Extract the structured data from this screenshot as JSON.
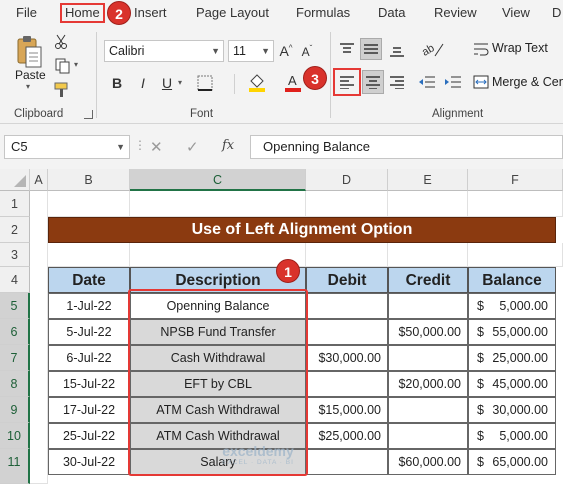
{
  "tabs": [
    "File",
    "Home",
    "Insert",
    "Page Layout",
    "Formulas",
    "Data",
    "Review",
    "View",
    "D"
  ],
  "badges": {
    "one": "1",
    "two": "2",
    "three": "3"
  },
  "clipboard": {
    "paste_label": "Paste",
    "group_label": "Clipboard"
  },
  "font": {
    "name": "Calibri",
    "size": "11",
    "bold": "B",
    "italic": "I",
    "underline": "U",
    "group_label": "Font"
  },
  "alignment": {
    "wrap_text": "Wrap Text",
    "merge_center": "Merge & Cen",
    "group_label": "Alignment"
  },
  "formula_bar": {
    "name_box": "C5",
    "fx": "fx",
    "value": "Openning Balance"
  },
  "columns": [
    "A",
    "B",
    "C",
    "D",
    "E",
    "F"
  ],
  "rows": [
    "1",
    "2",
    "3",
    "4",
    "5",
    "6",
    "7",
    "8",
    "9",
    "10",
    "11"
  ],
  "sheet": {
    "title": "Use of Left Alignment Option",
    "headers": [
      "Date",
      "Description",
      "Debit",
      "Credit",
      "Balance"
    ],
    "records": [
      {
        "date": "1-Jul-22",
        "desc": "Openning Balance",
        "debit": "",
        "credit": "",
        "balance": "5,000.00"
      },
      {
        "date": "5-Jul-22",
        "desc": "NPSB Fund Transfer",
        "debit": "",
        "credit": "$50,000.00",
        "balance": "55,000.00"
      },
      {
        "date": "6-Jul-22",
        "desc": "Cash Withdrawal",
        "debit": "$30,000.00",
        "credit": "",
        "balance": "25,000.00"
      },
      {
        "date": "15-Jul-22",
        "desc": "EFT by CBL",
        "debit": "",
        "credit": "$20,000.00",
        "balance": "45,000.00"
      },
      {
        "date": "17-Jul-22",
        "desc": "ATM Cash Withdrawal",
        "debit": "$15,000.00",
        "credit": "",
        "balance": "30,000.00"
      },
      {
        "date": "25-Jul-22",
        "desc": "ATM Cash Withdrawal",
        "debit": "$25,000.00",
        "credit": "",
        "balance": "5,000.00"
      },
      {
        "date": "30-Jul-22",
        "desc": "Salary",
        "debit": "",
        "credit": "$60,000.00",
        "balance": "65,000.00"
      }
    ],
    "currency_symbol": "$"
  },
  "watermark": {
    "name": "exceldemy",
    "tagline": "EXCEL · DATA · BI"
  },
  "colors": {
    "accent_green": "#217346",
    "title_fill": "#8b3a10",
    "header_fill": "#bcd6ee",
    "highlight_red": "#e53935"
  }
}
